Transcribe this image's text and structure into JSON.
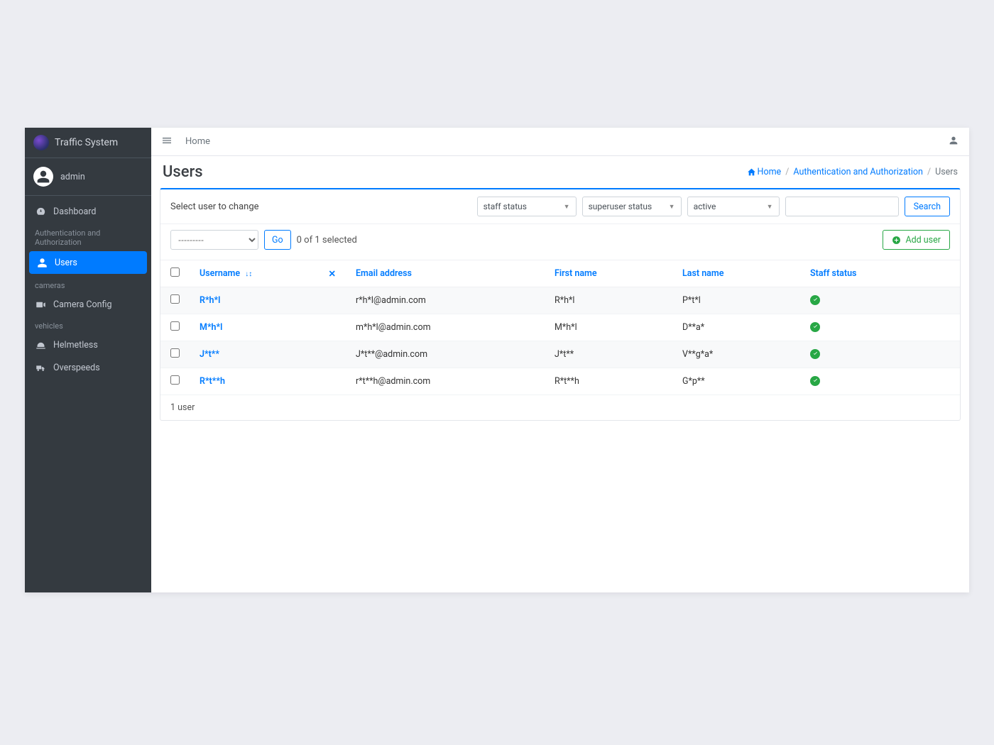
{
  "brand": {
    "title": "Traffic System"
  },
  "user": {
    "name": "admin"
  },
  "sidebar": {
    "items": [
      {
        "label": "Dashboard"
      },
      {
        "header": "Authentication and Authorization"
      },
      {
        "label": "Users",
        "active": true
      },
      {
        "header": "cameras"
      },
      {
        "label": "Camera Config"
      },
      {
        "header": "vehicles"
      },
      {
        "label": "Helmetless"
      },
      {
        "label": "Overspeeds"
      }
    ]
  },
  "topbar": {
    "home": "Home"
  },
  "page": {
    "title": "Users",
    "breadcrumb": {
      "home": "Home",
      "auth": "Authentication and Authorization",
      "current": "Users"
    }
  },
  "changelist": {
    "select_label": "Select user to change",
    "filters": {
      "staff": "staff status",
      "superuser": "superuser status",
      "active": "active"
    },
    "search_btn": "Search",
    "action_placeholder": "---------",
    "go": "Go",
    "selection_text": "0 of 1 selected",
    "add_user": "Add user",
    "columns": {
      "username": "Username",
      "email": "Email address",
      "first_name": "First name",
      "last_name": "Last name",
      "staff_status": "Staff status"
    },
    "rows": [
      {
        "username": "R*h*l",
        "email": "r*h*l@admin.com",
        "first_name": "R*h*l",
        "last_name": "P*t*l",
        "staff": true
      },
      {
        "username": "M*h*l",
        "email": "m*h*l@admin.com",
        "first_name": "M*h*l",
        "last_name": "D**a*",
        "staff": true
      },
      {
        "username": "J*t**",
        "email": "J*t**@admin.com",
        "first_name": "J*t**",
        "last_name": "V**g*a*",
        "staff": true
      },
      {
        "username": "R*t**h",
        "email": "r*t**h@admin.com",
        "first_name": "R*t**h",
        "last_name": "G*p**",
        "staff": true
      }
    ],
    "footer": "1 user"
  }
}
